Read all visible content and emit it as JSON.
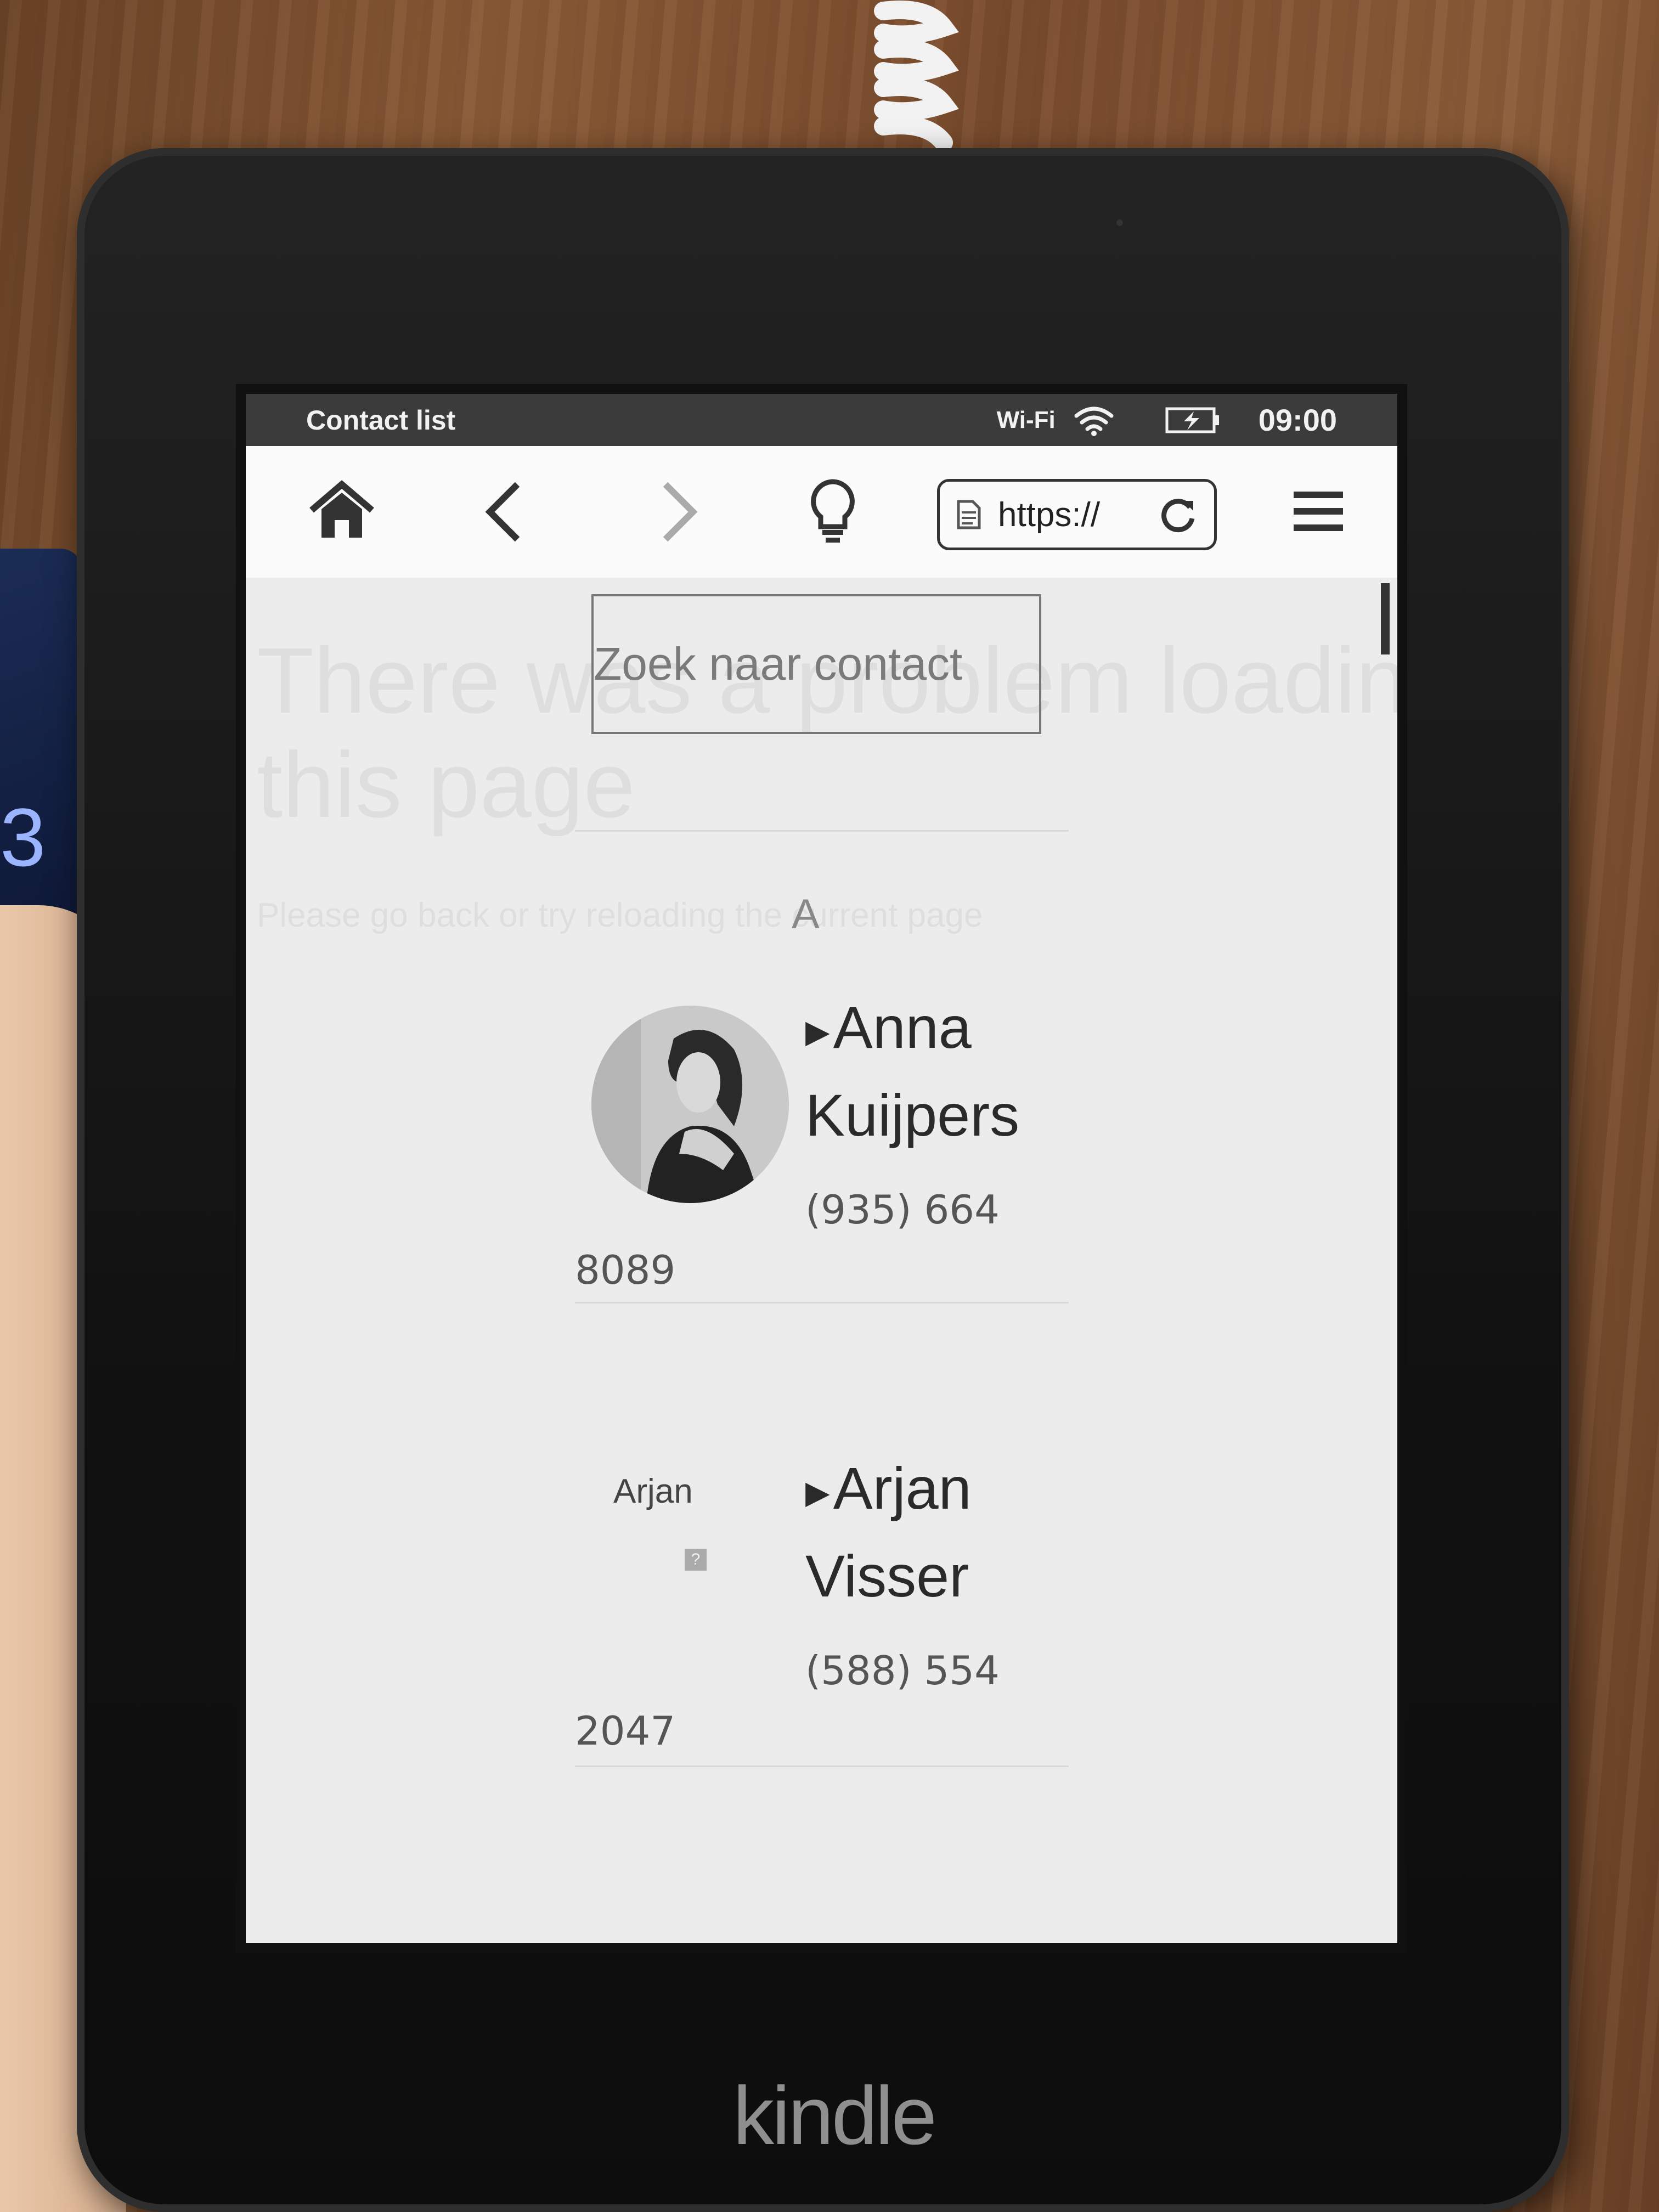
{
  "device": {
    "brand": "kindle"
  },
  "statusbar": {
    "title": "Contact list",
    "wifi_label": "Wi-Fi",
    "time": "09:00"
  },
  "toolbar": {
    "icons": [
      "home-icon",
      "back-icon",
      "forward-icon",
      "lightbulb-icon",
      "page-icon",
      "reload-icon",
      "menu-icon"
    ],
    "url": "https://"
  },
  "background_error": {
    "title_line1": "There was a problem loading",
    "title_line2": "this page",
    "subtitle": "Please go back or try reloading the current page"
  },
  "search": {
    "placeholder": "Zoek naar contact"
  },
  "section": {
    "letter": "A"
  },
  "contacts": [
    {
      "name_line1": "Anna",
      "name_line2": "Kuijpers",
      "phone_line1": "(935) 664",
      "phone_line2": "8089",
      "avatar_alt": ""
    },
    {
      "name_line1": "Arjan",
      "name_line2": "Visser",
      "phone_line1": "(588) 554",
      "phone_line2": "2047",
      "avatar_alt": "Arjan"
    }
  ],
  "colors": {
    "screen_bg": "#eeeeee",
    "statusbar_bg": "#3b3b3b",
    "bezel": "#111111"
  }
}
